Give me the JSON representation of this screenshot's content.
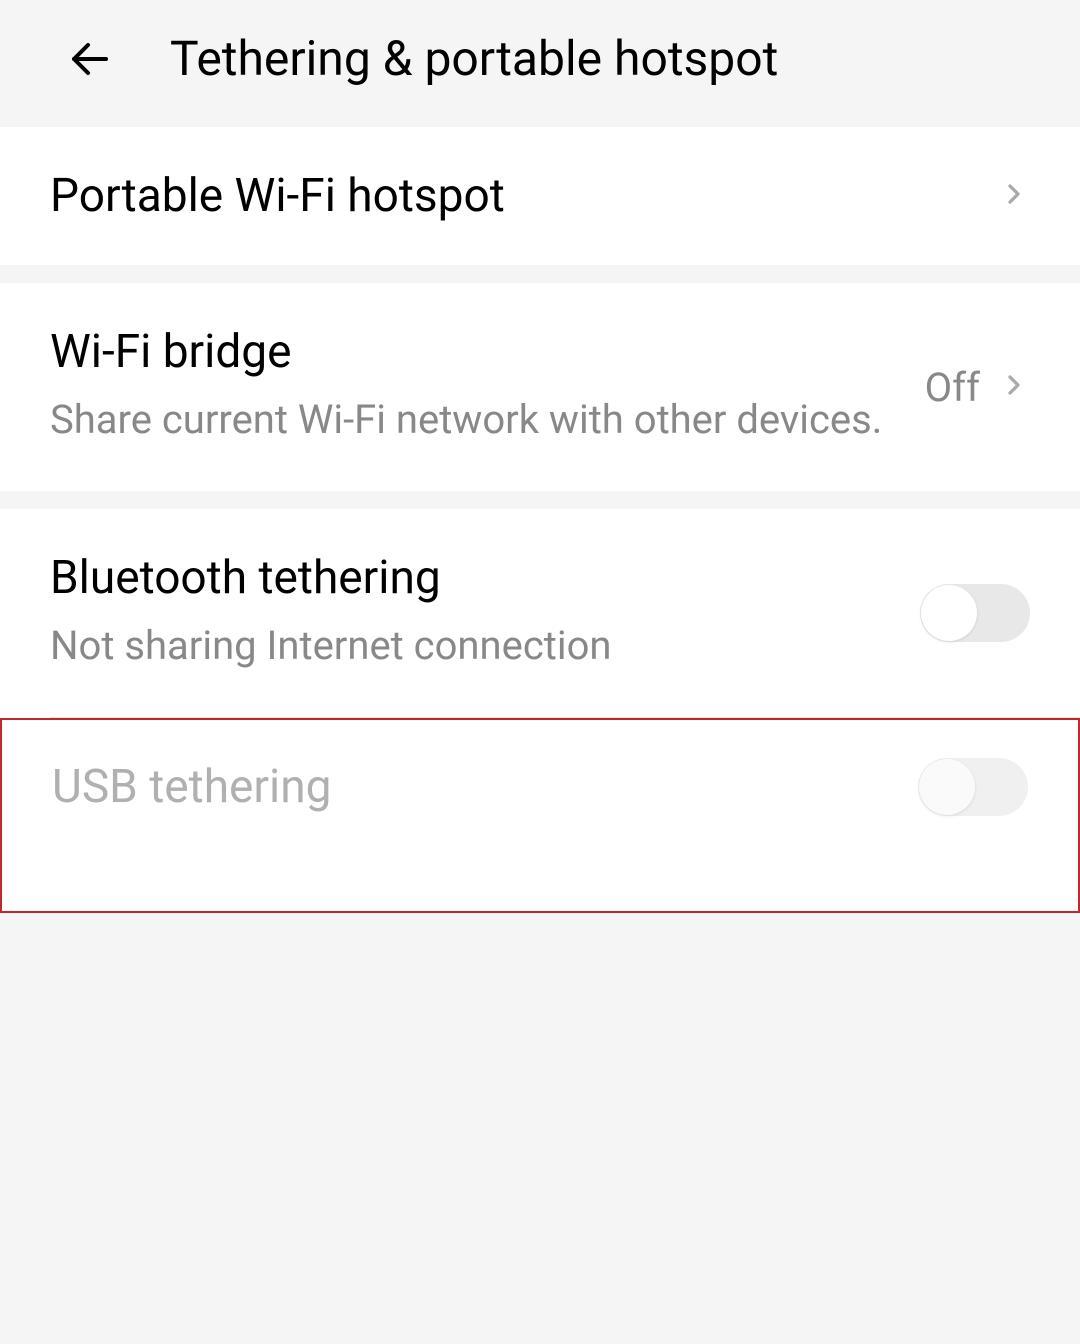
{
  "header": {
    "title": "Tethering & portable hotspot"
  },
  "items": {
    "portable_hotspot": {
      "title": "Portable Wi-Fi hotspot"
    },
    "wifi_bridge": {
      "title": "Wi-Fi bridge",
      "subtitle": "Share current Wi-Fi network with other devices.",
      "value": "Off"
    },
    "bluetooth_tethering": {
      "title": "Bluetooth tethering",
      "subtitle": "Not sharing Internet connection"
    },
    "usb_tethering": {
      "title": "USB tethering"
    }
  }
}
